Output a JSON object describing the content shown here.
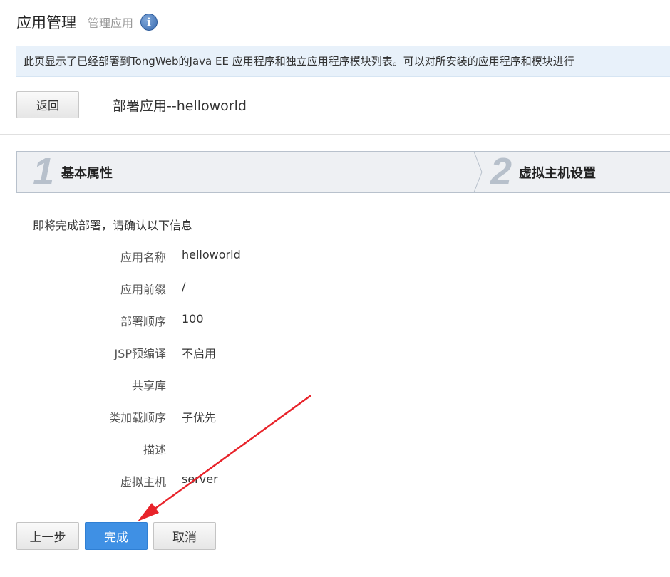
{
  "header": {
    "title": "应用管理",
    "subtitle": "管理应用",
    "info_icon_glyph": "i"
  },
  "description": "此页显示了已经部署到TongWeb的Java EE 应用程序和独立应用程序模块列表。可以对所安装的应用程序和模块进行",
  "toolbar": {
    "back_label": "返回",
    "deploy_title": "部署应用--helloworld"
  },
  "wizard": {
    "steps": [
      {
        "number": "1",
        "label": "基本属性"
      },
      {
        "number": "2",
        "label": "虚拟主机设置"
      }
    ]
  },
  "confirm": {
    "intro": "即将完成部署，请确认以下信息",
    "rows": [
      {
        "label": "应用名称",
        "value": "helloworld"
      },
      {
        "label": "应用前缀",
        "value": "/"
      },
      {
        "label": "部署顺序",
        "value": "100"
      },
      {
        "label": "JSP预编译",
        "value": "不启用"
      },
      {
        "label": "共享库",
        "value": ""
      },
      {
        "label": "类加载顺序",
        "value": "子优先"
      },
      {
        "label": "描述",
        "value": ""
      },
      {
        "label": "虚拟主机",
        "value": "server"
      }
    ]
  },
  "buttons": {
    "prev_label": "上一步",
    "finish_label": "完成",
    "cancel_label": "取消"
  },
  "colors": {
    "primary": "#3f90e4",
    "desc_bg": "#e8f1fa",
    "annotation_arrow": "#e8232a"
  }
}
